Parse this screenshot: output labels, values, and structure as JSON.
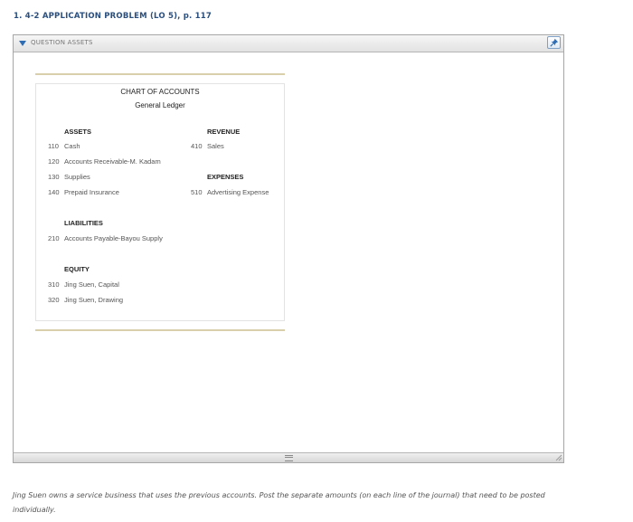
{
  "problem": {
    "title": "1. 4-2 APPLICATION PROBLEM (LO 5), p. 117"
  },
  "assets_panel": {
    "header_label": "QUESTION ASSETS",
    "collapse_icon": "triangle-down-icon",
    "pin_icon": "pin-icon"
  },
  "chart": {
    "title": "CHART OF ACCOUNTS",
    "subtitle": "General Ledger",
    "sections": {
      "assets": {
        "heading": "ASSETS",
        "accounts": [
          {
            "number": "110",
            "name": "Cash"
          },
          {
            "number": "120",
            "name": "Accounts Receivable-M. Kadam"
          },
          {
            "number": "130",
            "name": "Supplies"
          },
          {
            "number": "140",
            "name": "Prepaid Insurance"
          }
        ]
      },
      "liabilities": {
        "heading": "LIABILITIES",
        "accounts": [
          {
            "number": "210",
            "name": "Accounts Payable-Bayou Supply"
          }
        ]
      },
      "equity": {
        "heading": "EQUITY",
        "accounts": [
          {
            "number": "310",
            "name": "Jing Suen, Capital"
          },
          {
            "number": "320",
            "name": "Jing Suen, Drawing"
          }
        ]
      },
      "revenue": {
        "heading": "REVENUE",
        "accounts": [
          {
            "number": "410",
            "name": "Sales"
          }
        ]
      },
      "expenses": {
        "heading": "EXPENSES",
        "accounts": [
          {
            "number": "510",
            "name": "Advertising Expense"
          }
        ]
      }
    }
  },
  "instructions": "Jing Suen owns a service business that uses the previous accounts. Post the separate amounts (on each line of the journal) that need to be posted individually."
}
